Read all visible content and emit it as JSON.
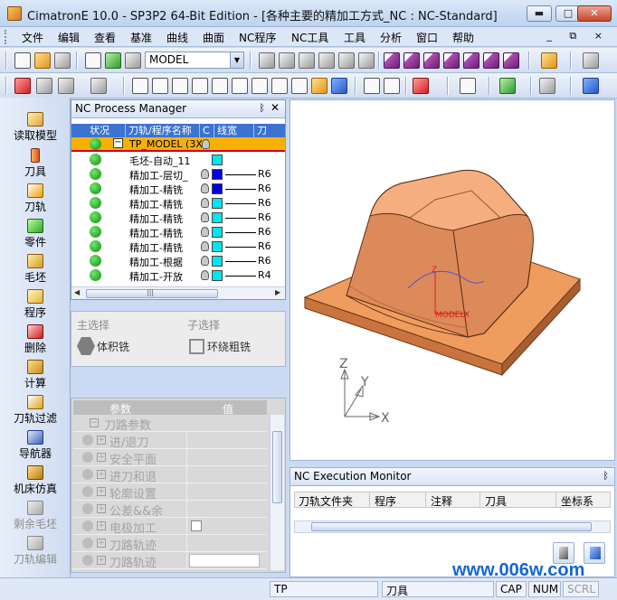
{
  "window": {
    "title": "CimatronE 10.0 - SP3P2 64-Bit Edition - [各种主要的精加工方式_NC : NC-Standard]",
    "minimize": "▬",
    "maximize": "□",
    "close": "✕"
  },
  "menu": {
    "items": [
      "文件",
      "编辑",
      "查看",
      "基准",
      "曲线",
      "曲面",
      "NC程序",
      "NC工具",
      "工具",
      "分析",
      "窗口",
      "帮助"
    ],
    "mdi_buttons": "_ ⧉ ×"
  },
  "toolbar": {
    "model_combo": "MODEL",
    "combo_arrow": "▼"
  },
  "sidebar": {
    "items": [
      {
        "label": "读取模型",
        "icon": "read-model-icon",
        "enabled": true
      },
      {
        "label": "刀具",
        "icon": "tool-icon",
        "enabled": true
      },
      {
        "label": "刀轨",
        "icon": "toolpath-icon",
        "enabled": true
      },
      {
        "label": "零件",
        "icon": "part-icon",
        "enabled": true
      },
      {
        "label": "毛坯",
        "icon": "stock-icon",
        "enabled": true
      },
      {
        "label": "程序",
        "icon": "procedure-icon",
        "enabled": true
      },
      {
        "label": "删除",
        "icon": "delete-icon",
        "enabled": true
      },
      {
        "label": "计算",
        "icon": "compute-icon",
        "enabled": true
      },
      {
        "label": "刀轨过滤",
        "icon": "toolpath-filter-icon",
        "enabled": true
      },
      {
        "label": "导航器",
        "icon": "navigator-icon",
        "enabled": true
      },
      {
        "label": "机床仿真",
        "icon": "machine-sim-icon",
        "enabled": true
      },
      {
        "label": "剩余毛坯",
        "icon": "remaining-stock-icon",
        "enabled": false
      },
      {
        "label": "刀轨编辑",
        "icon": "toolpath-edit-icon",
        "enabled": false
      }
    ]
  },
  "nc_process_manager": {
    "title": "NC Process Manager",
    "pin": "ᛒ",
    "close": "✕",
    "columns": [
      "状况",
      "刀轨/程序名称",
      "C",
      "线宽",
      "刀"
    ],
    "root": {
      "name": "TP_MODEL (3X",
      "expander": "−"
    },
    "rows": [
      {
        "name": "毛坯-自动_11",
        "color": "#00e5ef",
        "tool": "",
        "has_bulb": false
      },
      {
        "name": "精加工-层切_",
        "color": "#0000e8",
        "tool": "R6",
        "has_bulb": true
      },
      {
        "name": "精加工-精铣",
        "color": "#0000e8",
        "tool": "R6",
        "has_bulb": true
      },
      {
        "name": "精加工-精铣",
        "color": "#00e5ef",
        "tool": "R6",
        "has_bulb": true
      },
      {
        "name": "精加工-精铣",
        "color": "#00e5ef",
        "tool": "R6",
        "has_bulb": true
      },
      {
        "name": "精加工-精铣",
        "color": "#00e5ef",
        "tool": "R6",
        "has_bulb": true
      },
      {
        "name": "精加工-精铣",
        "color": "#00e5ef",
        "tool": "R6",
        "has_bulb": true
      },
      {
        "name": "精加工-根据",
        "color": "#00e5ef",
        "tool": "R6",
        "has_bulb": true
      },
      {
        "name": "精加工-开放",
        "color": "#00e5ef",
        "tool": "R4",
        "has_bulb": true
      }
    ],
    "scroll_left": "◀",
    "scroll_right": "▶",
    "scroll_grip": "|||"
  },
  "selection": {
    "main_label": "主选择",
    "sub_label": "子选择",
    "main_value": "体积铣",
    "sub_value": "环绕粗铣"
  },
  "parameters": {
    "header_param": "参数",
    "header_value": "值",
    "group": "刀路参数",
    "rows": [
      "进/退刀",
      "安全平面",
      "进刀和退",
      "轮廓设置",
      "公差&&余",
      "电极加工",
      "刀路轨迹",
      "刀路轨迹"
    ]
  },
  "viewport": {
    "triad_x": "X",
    "triad_y": "Y",
    "triad_z": "Z",
    "model_label": "MODEL",
    "mini_x": "X",
    "mini_z": "Z"
  },
  "nc_execution_monitor": {
    "title": "NC Execution Monitor",
    "pin": "ᛒ",
    "columns": [
      "刀轨文件夹",
      "程序",
      "注释",
      "刀具",
      "坐标系"
    ]
  },
  "statusbar": {
    "mode": "TP",
    "tool": "刀具",
    "cap": "CAP",
    "num": "NUM",
    "scrl": "SCRL"
  },
  "watermark": "www.006w.com",
  "colors": {
    "model_orange": "#e7996a",
    "selection_row": "#f7b100",
    "header_blue": "#3c73d1"
  }
}
